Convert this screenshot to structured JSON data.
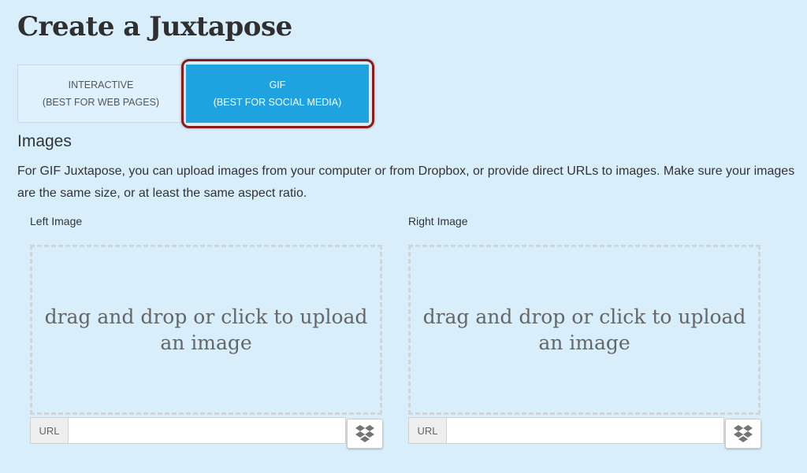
{
  "page": {
    "title": "Create a Juxtapose"
  },
  "mode_tabs": {
    "interactive": {
      "line1": "INTERACTIVE",
      "line2": "(BEST FOR WEB PAGES)",
      "selected": false
    },
    "gif": {
      "line1": "GIF",
      "line2": "(BEST FOR SOCIAL MEDIA)",
      "selected": true
    }
  },
  "images_section": {
    "heading": "Images",
    "description": "For GIF Juxtapose, you can upload images from your computer or from Dropbox, or provide direct URLs to images. Make sure your images are the same size, or at least the same aspect ratio."
  },
  "left_image": {
    "label": "Left Image",
    "dropzone_text": "drag and drop or click to upload an image",
    "url_addon": "URL",
    "url_value": "",
    "dropbox_icon": "dropbox-icon"
  },
  "right_image": {
    "label": "Right Image",
    "dropzone_text": "drag and drop or click to upload an image",
    "url_addon": "URL",
    "url_value": "",
    "dropbox_icon": "dropbox-icon"
  },
  "colors": {
    "background": "#d9eefb",
    "selected_tab": "#1ea2e0",
    "highlight_outline": "#8b1a1a"
  }
}
